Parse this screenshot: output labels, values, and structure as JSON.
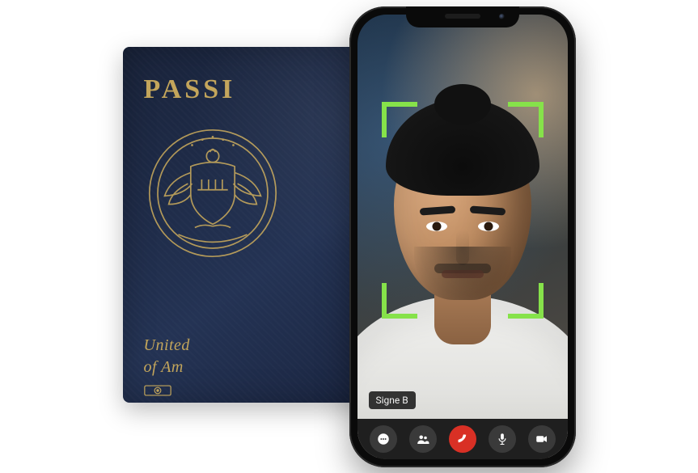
{
  "passport": {
    "title_visible": "PASSI",
    "country_line_visible": "United\nof Am"
  },
  "phone": {
    "caller_name": "Signe B",
    "scan_bracket_color": "#86e24a",
    "toolbar": {
      "chat_label": "chat",
      "people_label": "participants",
      "end_label": "end call",
      "mic_label": "microphone",
      "camera_label": "camera"
    }
  }
}
